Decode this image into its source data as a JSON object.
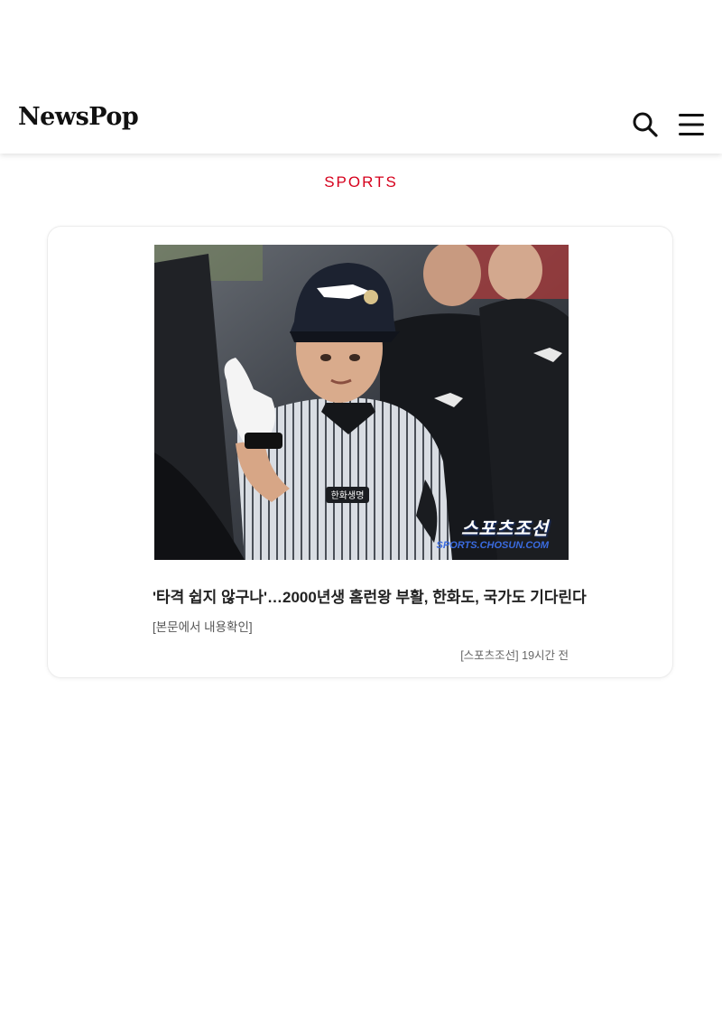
{
  "header": {
    "logo": "NewsPop",
    "search_icon": "search-icon",
    "menu_icon": "hamburger-menu-icon"
  },
  "category": "SPORTS",
  "colors": {
    "category_accent": "#d6001c",
    "header_bg": "#ffffff",
    "text_primary": "#222222"
  },
  "article": {
    "headline": "'타격 쉽지 않구나'…2000년생 홈런왕 부활, 한화도, 국가도 기다린다",
    "summary": "[본문에서 내용확인]",
    "source_time": "[스포츠조선] 19시간 전",
    "image": {
      "watermark": "스포츠조선",
      "watermark_sub": "SPORTS.CHOSUN.COM",
      "jersey_text": "한화생명"
    }
  }
}
